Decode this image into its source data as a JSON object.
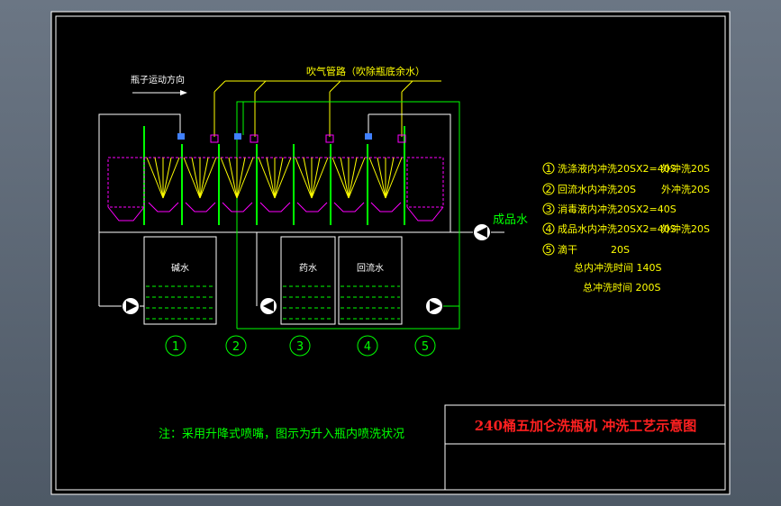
{
  "labels": {
    "bottle_direction": "瓶子运动方向",
    "air_pipe": "吹气管路（吹除瓶底余水）",
    "product_water": "成品水",
    "tank_a": "碱水",
    "tank_b": "药水",
    "tank_c": "回流水"
  },
  "stations": [
    "1",
    "2",
    "3",
    "4",
    "5"
  ],
  "process_steps": [
    {
      "num": "1",
      "text": "洗涤液内冲洗20SX2=40S",
      "outer": "外冲洗20S"
    },
    {
      "num": "2",
      "text": "回流水内冲洗20S",
      "outer": "外冲洗20S"
    },
    {
      "num": "3",
      "text": "消毒液内冲洗20SX2=40S",
      "outer": ""
    },
    {
      "num": "4",
      "text": "成品水内冲洗20SX2=40S",
      "outer": "外冲洗20S"
    },
    {
      "num": "5",
      "text": "滴干",
      "outer": "20S"
    }
  ],
  "totals": {
    "inner": "总内冲洗时间 140S",
    "all": "总冲洗时间 200S"
  },
  "note": "注：采用升降式喷嘴，图示为升入瓶内喷洗状况",
  "title": "240桶五加仑洗瓶机 冲洗工艺示意图",
  "colors": {
    "background": "#000000",
    "accent_green": "#00ff00",
    "accent_yellow": "#ffff00",
    "accent_magenta": "#ff00ff",
    "title_red": "#ff2020"
  }
}
